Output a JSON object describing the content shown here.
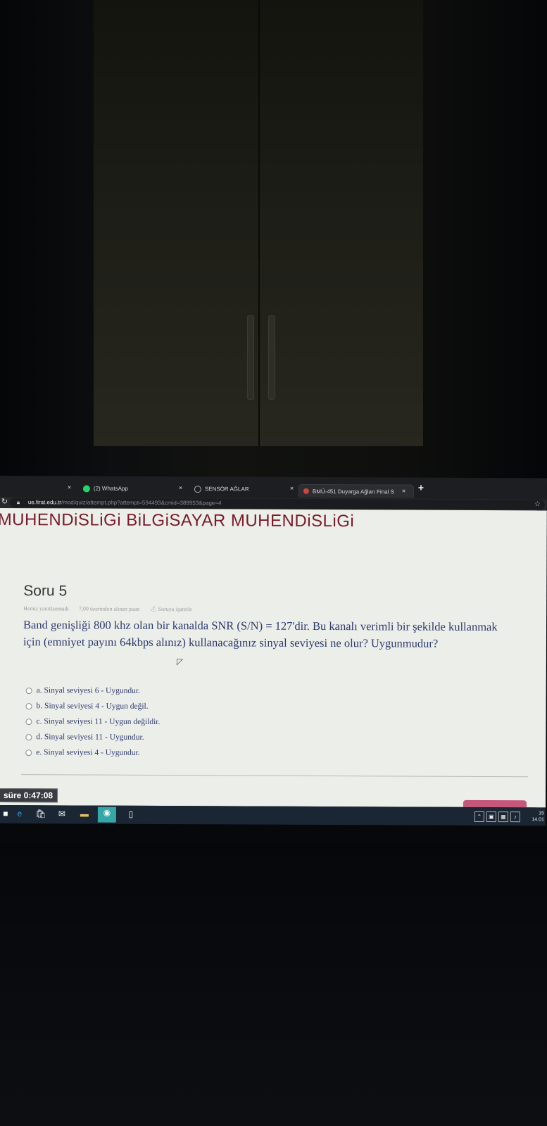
{
  "tabs": [
    {
      "label": "",
      "close": "×"
    },
    {
      "label": "(2) WhatsApp",
      "close": "×"
    },
    {
      "label": "SENSÖR AĞLAR",
      "close": "×"
    },
    {
      "label": "BMÜ-451 Duyarga Ağları Final S",
      "close": "×"
    }
  ],
  "new_tab": "+",
  "address": {
    "host": "ue.firat.edu.tr",
    "path": "/mod/quiz/attempt.php?attempt=594493&cmid=389953&page=4"
  },
  "page": {
    "banner": "MUHENDiSLiGi BiLGiSAYAR MUHENDiSLiGi",
    "question_title": "Soru 5",
    "info": {
      "status": "Henüz yanıtlanmadı",
      "points": "7,00 üzerinden alınan puan",
      "flag": "Soruyu işaretle"
    },
    "question_text": "Band genişliği 800 khz olan bir kanalda SNR (S/N) = 127'dir. Bu kanalı verimli bir şekilde kullanmak için (emniyet payını 64kbps alınız) kullanacağınız sinyal seviyesi ne olur? Uygunmudur?",
    "options": [
      "a. Sinyal seviyesi 6 - Uygundur.",
      "b. Sinyal seviyesi 4 - Uygun değil.",
      "c. Sinyal seviyesi 11 - Uygun değildir.",
      "d. Sinyal seviyesi 11 - Uygundur.",
      "e. Sinyal seviyesi 4 - Uygundur."
    ],
    "timer": "süre 0:47:08"
  },
  "taskbar": {
    "clock_time": "15",
    "clock_date": "14.01"
  }
}
